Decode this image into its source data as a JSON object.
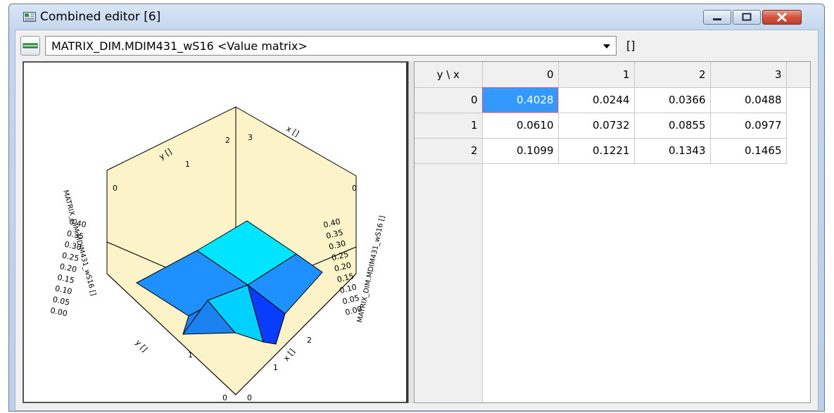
{
  "window": {
    "title": "Combined editor [6]",
    "controls": {
      "minimize": "minimize",
      "maximize": "maximize",
      "close": "close"
    }
  },
  "toolbar": {
    "selector_value": "MATRIX_DIM.MDIM431_wS16 <Value matrix>",
    "unit_label": "[]"
  },
  "plot": {
    "z_axis_label": "MATRIX_DIM.MDIM431_wS16 []",
    "z_ticks": [
      "0.00",
      "0.05",
      "0.10",
      "0.15",
      "0.20",
      "0.25",
      "0.30",
      "0.35",
      "0.40"
    ],
    "x_axis_label": "x []",
    "y_axis_label": "y []",
    "x_ticks": [
      "0",
      "1",
      "2",
      "3"
    ],
    "y_ticks": [
      "0",
      "1",
      "2"
    ],
    "colors": {
      "wall": "#fdf3c8",
      "surface_low": "#1e90ff",
      "surface_high": "#00e5ff",
      "surface_dark": "#0a3cff"
    }
  },
  "grid": {
    "corner": "y \\ x",
    "columns": [
      "0",
      "1",
      "2",
      "3"
    ],
    "rows": [
      {
        "label": "0",
        "values": [
          "0.4028",
          "0.0244",
          "0.0366",
          "0.0488"
        ]
      },
      {
        "label": "1",
        "values": [
          "0.0610",
          "0.0732",
          "0.0855",
          "0.0977"
        ]
      },
      {
        "label": "2",
        "values": [
          "0.1099",
          "0.1221",
          "0.1343",
          "0.1465"
        ]
      }
    ],
    "selected_cell": "0,0",
    "selection_color": "#3399ff"
  }
}
